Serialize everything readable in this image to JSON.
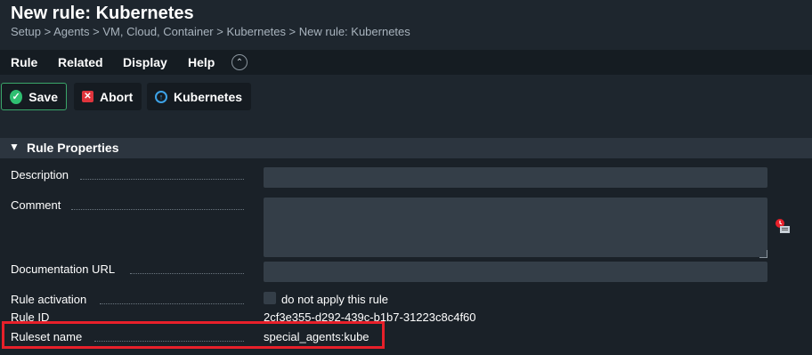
{
  "header": {
    "title": "New rule: Kubernetes",
    "breadcrumb": "Setup > Agents > VM, Cloud, Container > Kubernetes > New rule: Kubernetes"
  },
  "menu": {
    "items": [
      "Rule",
      "Related",
      "Display",
      "Help"
    ],
    "collapse_icon": "chevron-up-circle-icon"
  },
  "toolbar": {
    "save_label": "Save",
    "abort_label": "Abort",
    "kubernetes_label": "Kubernetes"
  },
  "section": {
    "title": "Rule Properties",
    "fields": {
      "description": {
        "label": "Description",
        "value": ""
      },
      "comment": {
        "label": "Comment",
        "value": ""
      },
      "documentation_url": {
        "label": "Documentation URL",
        "value": ""
      },
      "rule_activation": {
        "label": "Rule activation",
        "checkbox_label": "do not apply this rule",
        "checked": false
      },
      "rule_id": {
        "label": "Rule ID",
        "value": "2cf3e355-d292-439c-b1b7-31223c8c4f60"
      },
      "ruleset_name": {
        "label": "Ruleset name",
        "value": "special_agents:kube"
      }
    }
  },
  "colors": {
    "background": "#1e262e",
    "accent_green": "#2fbf71",
    "highlight_red": "#e8202a"
  }
}
